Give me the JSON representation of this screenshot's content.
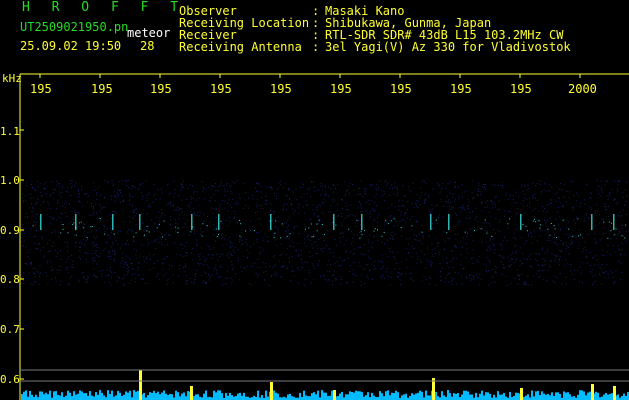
{
  "app": {
    "title": "H R O F F T",
    "filename": "UT2509021950.pn",
    "meteor_label": "meteor",
    "datetime": "25.09.02 19:50",
    "meteor_count": "28"
  },
  "header": {
    "rows": [
      {
        "label": "Observer",
        "value": "Masaki Kano"
      },
      {
        "label": "Receiving Location",
        "value": "Shibukawa, Gunma, Japan"
      },
      {
        "label": "Receiver",
        "value": "RTL-SDR SDR# 43dB L15 103.2MHz CW"
      },
      {
        "label": "Receiving Antenna",
        "value": "3el Yagi(V) Az 330 for Vladivostok"
      }
    ],
    "separator": ":"
  },
  "axes": {
    "freq_unit": "kHz",
    "freq_ticks": [
      "1.1",
      "1.0",
      "0.9",
      "0.8",
      "0.7",
      "0.6"
    ],
    "time_ticks": [
      "195",
      "195",
      "195",
      "195",
      "195",
      "195",
      "195",
      "195",
      "195",
      "2000"
    ]
  },
  "colors": {
    "header_text": "#ffff33",
    "title_text": "#22dd22",
    "labels_text": "#ffffff",
    "signal_band": "#2233aa",
    "signal_peak": "#44ffff",
    "activity_bar": "#00bbff",
    "activity_peak": "#ffff33"
  }
}
